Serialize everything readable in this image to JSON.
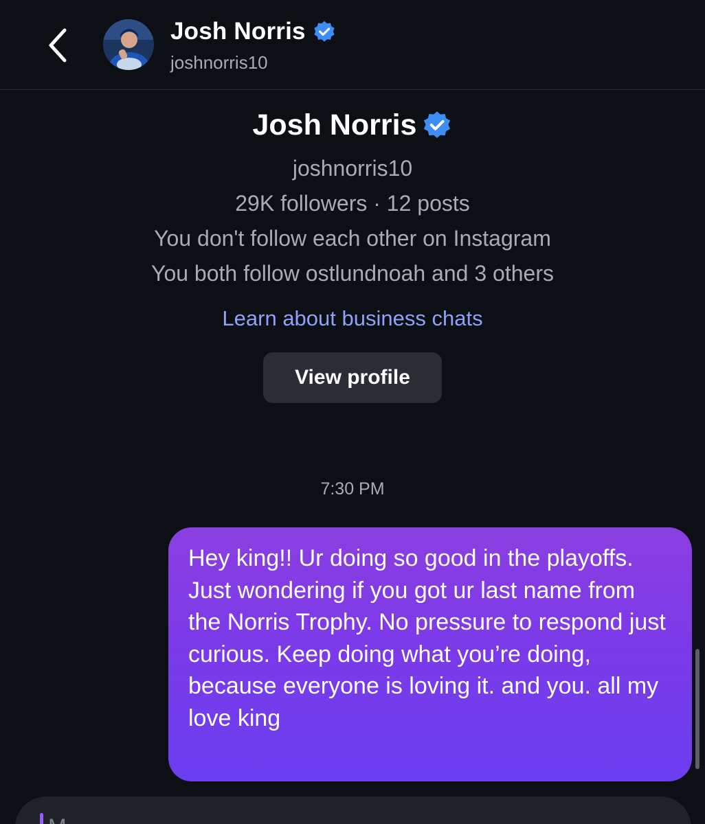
{
  "header": {
    "name": "Josh Norris",
    "username": "joshnorris10",
    "back_icon": "chevron-left-icon",
    "verified_icon": "verified-badge-icon"
  },
  "profile": {
    "name": "Josh Norris",
    "username": "joshnorris10",
    "stats": "29K followers · 12 posts",
    "follow_status": "You don't follow each other on Instagram",
    "mutuals": "You both follow ostlundnoah and 3 others",
    "learn_link": "Learn about business chats",
    "view_profile_label": "View profile"
  },
  "conversation": {
    "timestamp": "7:30 PM",
    "messages": [
      {
        "sender": "me",
        "text": "Hey king!! Ur doing so good in the playoffs. Just wondering if you got ur last name from the Norris Trophy. No pressure to respond just curious. Keep doing what you’re doing, because everyone is loving it. and you. all my love king"
      }
    ]
  },
  "composer": {
    "partial_text": "M"
  },
  "colors": {
    "background": "#0c0f14",
    "bubble_top": "#8a3fe0",
    "bubble_bottom": "#6a3ff0",
    "link": "#8ea2f7",
    "verified": "#3d8df5",
    "secondary_text": "#a8acb3",
    "button": "#2a2d33"
  }
}
